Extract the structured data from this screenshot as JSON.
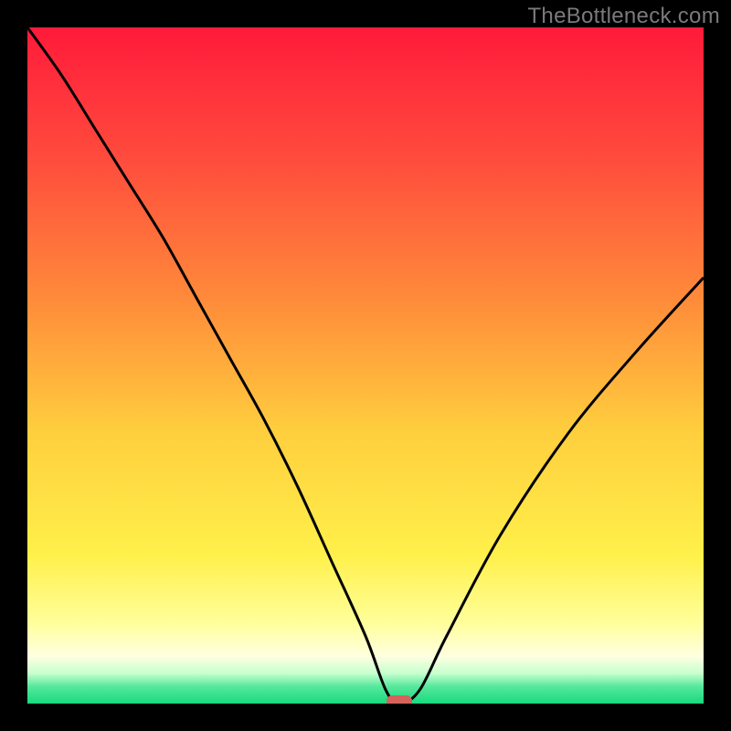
{
  "watermark": "TheBottleneck.com",
  "chart_data": {
    "type": "line",
    "title": "",
    "xlabel": "",
    "ylabel": "",
    "xlim": [
      0,
      100
    ],
    "ylim": [
      0,
      100
    ],
    "grid": false,
    "legend": false,
    "series": [
      {
        "name": "bottleneck-curve",
        "x": [
          0,
          5,
          10,
          15,
          20,
          25,
          30,
          35,
          40,
          45,
          50,
          53,
          55,
          58,
          62,
          70,
          80,
          90,
          100
        ],
        "values": [
          100,
          93,
          85,
          77,
          69,
          60,
          51,
          42,
          32,
          21,
          10,
          2,
          0,
          2,
          10,
          25,
          40,
          52,
          63
        ]
      }
    ],
    "marker": {
      "x": 55,
      "y": 0,
      "color": "#d4635c"
    },
    "gradient_stops": [
      {
        "offset": 0.0,
        "color": "#ff1a3a"
      },
      {
        "offset": 0.2,
        "color": "#ff4d3d"
      },
      {
        "offset": 0.4,
        "color": "#ff8a3a"
      },
      {
        "offset": 0.6,
        "color": "#ffcf3e"
      },
      {
        "offset": 0.78,
        "color": "#fff04a"
      },
      {
        "offset": 0.88,
        "color": "#ffff9a"
      },
      {
        "offset": 0.93,
        "color": "#ffffe0"
      },
      {
        "offset": 0.955,
        "color": "#c7ffcf"
      },
      {
        "offset": 0.975,
        "color": "#55e89b"
      },
      {
        "offset": 1.0,
        "color": "#18d97f"
      }
    ]
  }
}
